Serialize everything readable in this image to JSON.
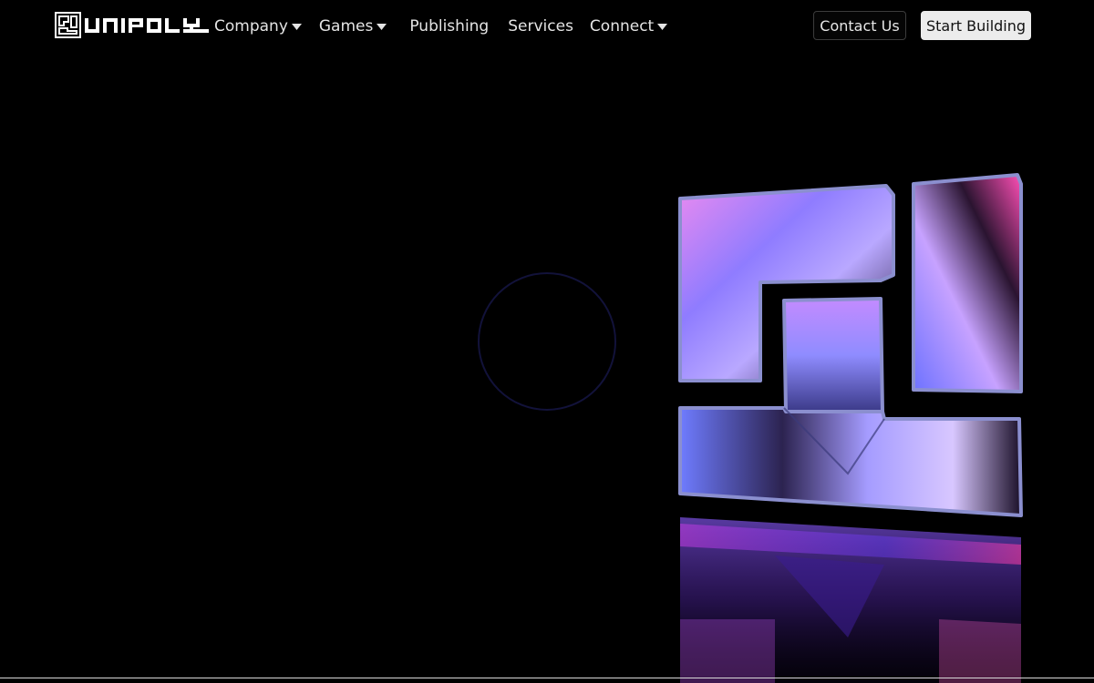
{
  "header": {
    "brand": "UNIPOLY",
    "nav": [
      {
        "label": "Company",
        "has_dropdown": true,
        "icon": "caret-down-icon"
      },
      {
        "label": "Games",
        "has_dropdown": true,
        "icon": "caret-down-icon"
      },
      {
        "label": "Publishing",
        "has_dropdown": false
      },
      {
        "label": "Services",
        "has_dropdown": false
      },
      {
        "label": "Connect",
        "has_dropdown": true,
        "icon": "caret-down-icon"
      }
    ],
    "contact_label": "Contact Us",
    "start_label": "Start Building"
  },
  "hero": {
    "loader_icon": "loading-ring-icon",
    "art_icon": "unipoly-3d-logo"
  },
  "colors": {
    "background": "#000000",
    "nav_text": "#e4e4e4",
    "button_light": "#ececec",
    "accent_violet": "#a48cff",
    "accent_pink": "#e14ad9"
  }
}
